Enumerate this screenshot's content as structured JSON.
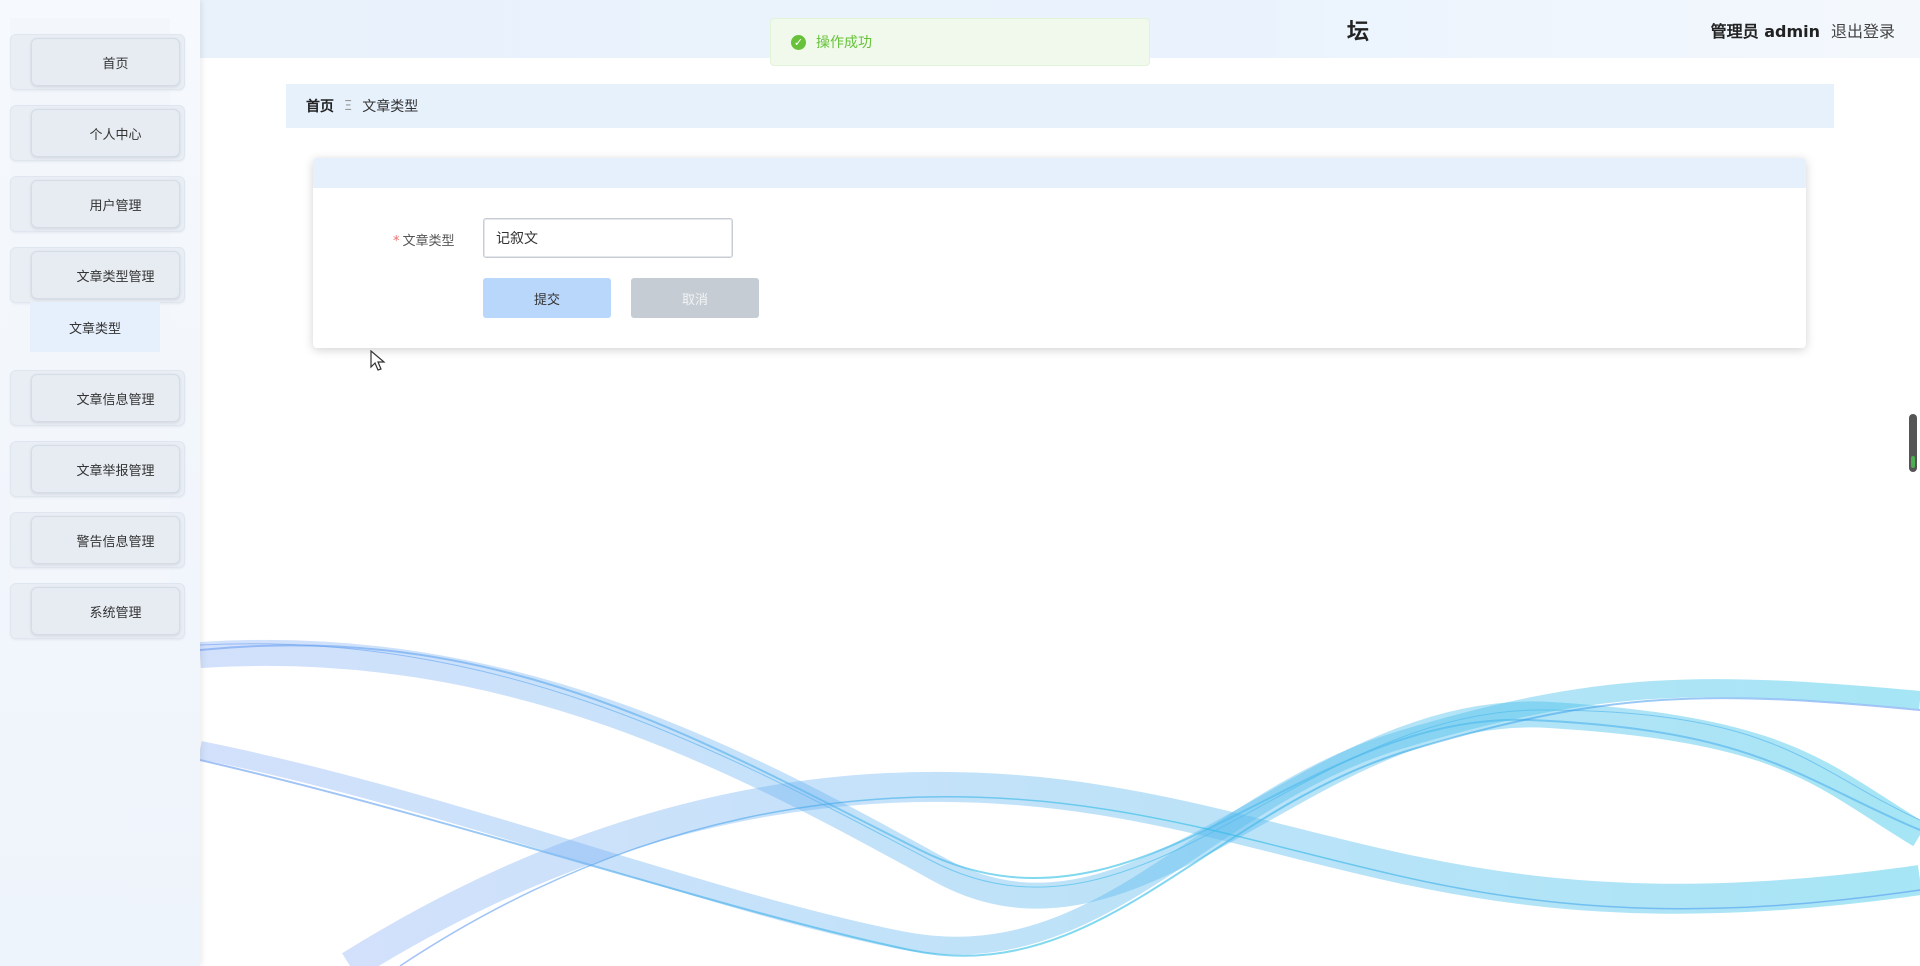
{
  "header": {
    "title_fragment": "坛",
    "user_label": "管理员 admin",
    "logout_label": "退出登录"
  },
  "toast": {
    "icon": "check-circle-icon",
    "message": "操作成功",
    "color": "#67c23a"
  },
  "sidebar": {
    "items": [
      {
        "label": "首页"
      },
      {
        "label": "个人中心"
      },
      {
        "label": "用户管理"
      },
      {
        "label": "文章类型管理"
      },
      {
        "label": "文章信息管理"
      },
      {
        "label": "文章举报管理"
      },
      {
        "label": "警告信息管理"
      },
      {
        "label": "系统管理"
      }
    ],
    "submenu": {
      "label": "文章类型"
    }
  },
  "breadcrumb": {
    "home": "首页",
    "separator": "Ξ",
    "current": "文章类型"
  },
  "form": {
    "field_label": "文章类型",
    "required_mark": "*",
    "field_value": "记叙文",
    "submit_label": "提交",
    "cancel_label": "取消"
  },
  "colors": {
    "accent": "#b9d6fb",
    "header_bg": "#e9f1fb",
    "success": "#67c23a",
    "required": "#f56c6c"
  }
}
